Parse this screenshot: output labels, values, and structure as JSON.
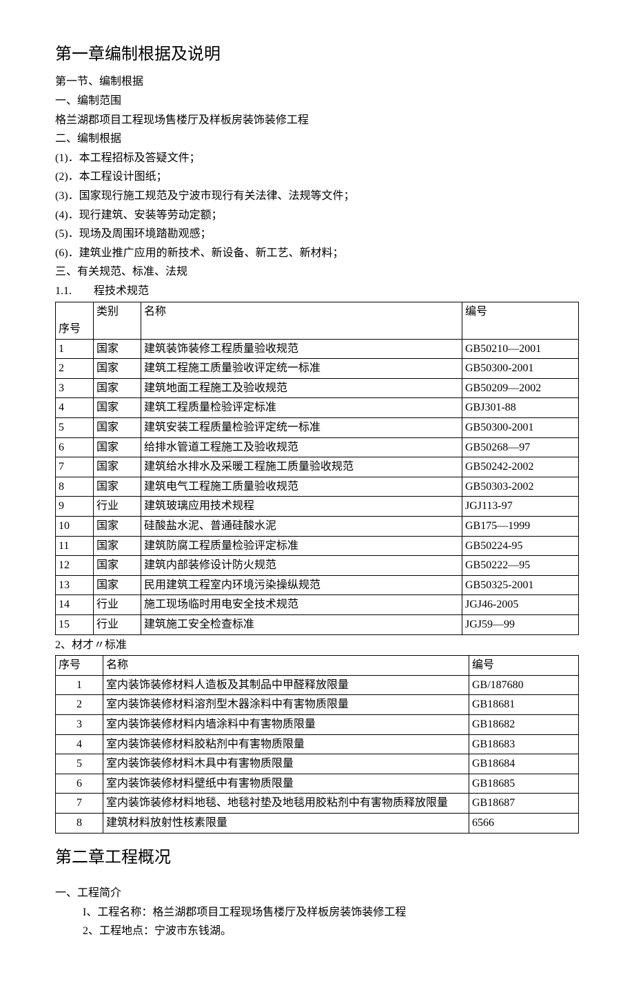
{
  "chapter1": {
    "title": "第一章编制根据及说明",
    "section1_title": "第一节、编制根据",
    "part1_title": "一、编制范围",
    "part1_body": "格兰湖郡项目工程现场售楼厅及样板房装饰装修工程",
    "part2_title": "二、编制根据",
    "basis": [
      "(1)．本工程招标及答疑文件；",
      "(2)．本工程设计图纸；",
      "(3)．国家现行施工规范及宁波市现行有关法律、法规等文件；",
      "(4)．现行建筑、安装等劳动定额；",
      "(5)．现场及周围环境踏勘观感；",
      "(6)．建筑业推广应用的新技术、新设备、新工艺、新材料；"
    ],
    "part3_title": "三、有关规范、标准、法规",
    "spec_heading": "1.1.　　程技术规范",
    "table1": {
      "headers": {
        "seq": "序号",
        "cat": "类别",
        "name": "名称",
        "code": "编号"
      },
      "rows": [
        {
          "seq": "1",
          "cat": "国家",
          "name": "建筑装饰装修工程质量验收规范",
          "code": "GB50210—2001"
        },
        {
          "seq": "2",
          "cat": "国家",
          "name": "建筑工程施工质量验收评定统一标准",
          "code": "GB50300-2001"
        },
        {
          "seq": "3",
          "cat": "国家",
          "name": "建筑地面工程施工及验收规范",
          "code": "GB50209—2002"
        },
        {
          "seq": "4",
          "cat": "国家",
          "name": "建筑工程质量检验评定标准",
          "code": "GBJ301-88"
        },
        {
          "seq": "5",
          "cat": "国家",
          "name": "建筑安装工程质量检验评定统一标准",
          "code": "GB50300-2001"
        },
        {
          "seq": "6",
          "cat": "国家",
          "name": "给排水管道工程施工及验收规范",
          "code": "GB50268—97"
        },
        {
          "seq": "7",
          "cat": "国家",
          "name": "建筑给水排水及采暖工程施工质量验收规范",
          "code": "GB50242-2002"
        },
        {
          "seq": "8",
          "cat": "国家",
          "name": "建筑电气工程施工质量验收规范",
          "code": "GB50303-2002"
        },
        {
          "seq": "9",
          "cat": "行业",
          "name": "建筑玻璃应用技术规程",
          "code": "JGJ113-97"
        },
        {
          "seq": "10",
          "cat": "国家",
          "name": "硅酸盐水泥、普通硅酸水泥",
          "code": "GB175—1999"
        },
        {
          "seq": "11",
          "cat": "国家",
          "name": "建筑防腐工程质量检验评定标准",
          "code": "GB50224-95"
        },
        {
          "seq": "12",
          "cat": "国家",
          "name": "建筑内部装修设计防火规范",
          "code": "GB50222—95"
        },
        {
          "seq": "13",
          "cat": "国家",
          "name": "民用建筑工程室内环境污染操纵规范",
          "code": "GB50325-2001"
        },
        {
          "seq": "14",
          "cat": "行业",
          "name": "施工现场临时用电安全技术规范",
          "code": "JGJ46-2005"
        },
        {
          "seq": "15",
          "cat": "行业",
          "name": "建筑施工安全检查标准",
          "code": "JGJ59—99"
        }
      ]
    },
    "mat_heading": "2、材才〃标准",
    "table2": {
      "headers": {
        "seq": "序号",
        "name": "名称",
        "code": "编号"
      },
      "rows": [
        {
          "seq": "1",
          "name": "室内装饰装修材料人造板及其制品中甲醛释放限量",
          "code": "GB/187680"
        },
        {
          "seq": "2",
          "name": "室内装饰装修材料溶剂型木器涂料中有害物质限量",
          "code": "GB18681"
        },
        {
          "seq": "3",
          "name": "室内装饰装修材料内墙涂料中有害物质限量",
          "code": "GB18682"
        },
        {
          "seq": "4",
          "name": "室内装饰装修材料胶粘剂中有害物质限量",
          "code": "GB18683"
        },
        {
          "seq": "5",
          "name": "室内装饰装修材料木具中有害物质限量",
          "code": "GB18684"
        },
        {
          "seq": "6",
          "name": "室内装饰装修材料壁纸中有害物质限量",
          "code": "GB18685"
        },
        {
          "seq": "7",
          "name": "室内装饰装修材料地毯、地毯衬垫及地毯用胶粘剂中有害物质释放限量",
          "code": "GB18687"
        },
        {
          "seq": "8",
          "name": "建筑材料放射性核素限量",
          "code": "6566"
        }
      ]
    }
  },
  "chapter2": {
    "title": "第二章工程概况",
    "part1_title": "一、工程简介",
    "items": [
      "I、工程名称：格兰湖郡项目工程现场售楼厅及样板房装饰装修工程",
      "2、工程地点：宁波市东钱湖。"
    ]
  }
}
